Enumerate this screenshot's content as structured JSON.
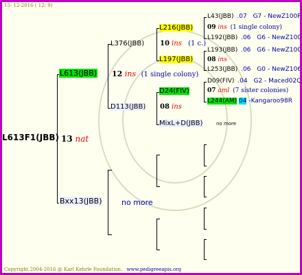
{
  "header": {
    "date": "15- 12-2016 ( 12: 9)"
  },
  "footer": {
    "copyright": "Copyright 2004-2016 @ Karl Kehrle Foundation.",
    "site": "www.pedigreeapis.org"
  },
  "root": {
    "name": "L613F1(JBB)",
    "num": "13",
    "tag": "nat"
  },
  "f1": {
    "name": "L613(JBB)",
    "num": "12",
    "tag": "ins",
    "note": "(1 single colony)"
  },
  "f2": {
    "name": "Bxx13(JBB)",
    "note": "no more"
  },
  "ff": {
    "name": "L376(JBB)",
    "num": "10",
    "tag": "ins",
    "note": "(1 c.)"
  },
  "fm": {
    "name": "D113(JBB)",
    "num": "08",
    "tag": "ins"
  },
  "fmm": {
    "name": "MixL+D(JBB)",
    "note": "no more"
  },
  "g1": {
    "name": "L216(JBB)",
    "num": "09",
    "tag": "ins",
    "note": "(1 single colony)"
  },
  "g2": {
    "name": "L197(JBB)",
    "num": "08",
    "tag": "ins"
  },
  "g3": {
    "name": "D24(FIV)",
    "num": "07",
    "tag": "aml",
    "note": "(7 sister colonies)"
  },
  "g4": {
    "name": "L244(AM)",
    "code": "04",
    "right": "-Kangaroo98R"
  },
  "h1": {
    "name": "L43(JBB)",
    "year": ".07",
    "code": "G7 - NewZ100R"
  },
  "h2": {
    "name": "L192(JBB)",
    "year": ".06",
    "code": "G6 - NewZ100R"
  },
  "h3": {
    "name": "L193(JBB)",
    "year": ".06",
    "code": "G6 - NewZ100R"
  },
  "h4": {
    "name": "L253(JBB)",
    "year": ".06",
    "code": "G0 - NewZ106R"
  },
  "h5": {
    "name": "D09(FIV)",
    "year": ".04",
    "code": "G2 - Maced02Q"
  }
}
